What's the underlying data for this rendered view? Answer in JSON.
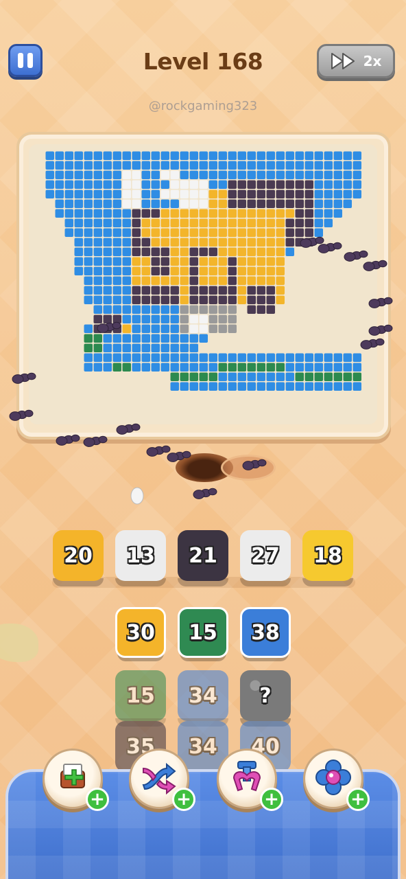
{
  "header": {
    "level_title": "Level 168",
    "username": "@rockgaming323",
    "speed_label": "2x"
  },
  "board": {
    "palette": {
      "B": "#2f8de4",
      "Y": "#f3b52b",
      "D": "#4a3a52",
      "W": "#f4f4f4",
      "G": "#9a9a9a",
      "N": "#2c8a4f"
    }
  },
  "tiles": {
    "slots": [
      {
        "value": "20",
        "color": "#f4b42a"
      },
      {
        "value": "13",
        "color": "#ececec"
      },
      {
        "value": "21",
        "color": "#3c3442"
      },
      {
        "value": "27",
        "color": "#ececec"
      },
      {
        "value": "18",
        "color": "#f6c92f"
      }
    ],
    "queue": [
      {
        "value": "30",
        "color": "#f4b42a"
      },
      {
        "value": "15",
        "color": "#2f8a52"
      },
      {
        "value": "38",
        "color": "#3b7ed9"
      },
      {
        "value": "15",
        "color": "#2f8a52"
      },
      {
        "value": "34",
        "color": "#3b7ed9"
      },
      {
        "value": "?",
        "color": "#7a7a7a"
      },
      {
        "value": "35",
        "color": "#3c3442"
      },
      {
        "value": "34",
        "color": "#3b7ed9"
      },
      {
        "value": "40",
        "color": "#3b7ed9"
      }
    ]
  },
  "boosters": [
    {
      "icon": "add-slot-icon"
    },
    {
      "icon": "shuffle-icon"
    },
    {
      "icon": "magnet-claw-icon"
    },
    {
      "icon": "flower-icon"
    }
  ]
}
